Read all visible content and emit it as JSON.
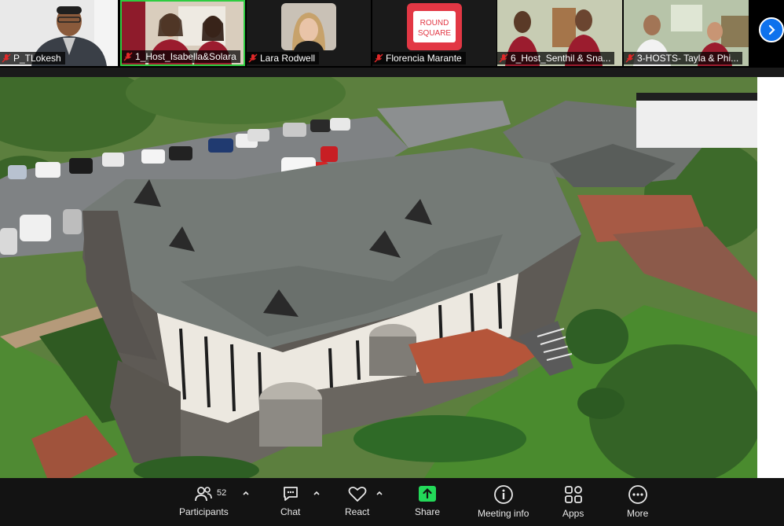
{
  "participants": [
    {
      "name": "P_TLokesh"
    },
    {
      "name": "1_Host_Isabella&Solara"
    },
    {
      "name": "Lara Rodwell"
    },
    {
      "name": "Florencia Marante",
      "logo_text_1": "ROUND",
      "logo_text_2": "SQUARE"
    },
    {
      "name": "6_Host_Senthil & Sna..."
    },
    {
      "name": "3-HOSTS- Tayla & Phi..."
    }
  ],
  "colors": {
    "active_speaker_border": "#2ecc40",
    "accent": "#0e72ed",
    "share_green": "#23d959",
    "mute_red": "#e02828"
  },
  "toolbar": {
    "participants_label": "Participants",
    "participants_count": "52",
    "chat_label": "Chat",
    "react_label": "React",
    "share_label": "Share",
    "meeting_info_label": "Meeting info",
    "apps_label": "Apps",
    "more_label": "More"
  }
}
